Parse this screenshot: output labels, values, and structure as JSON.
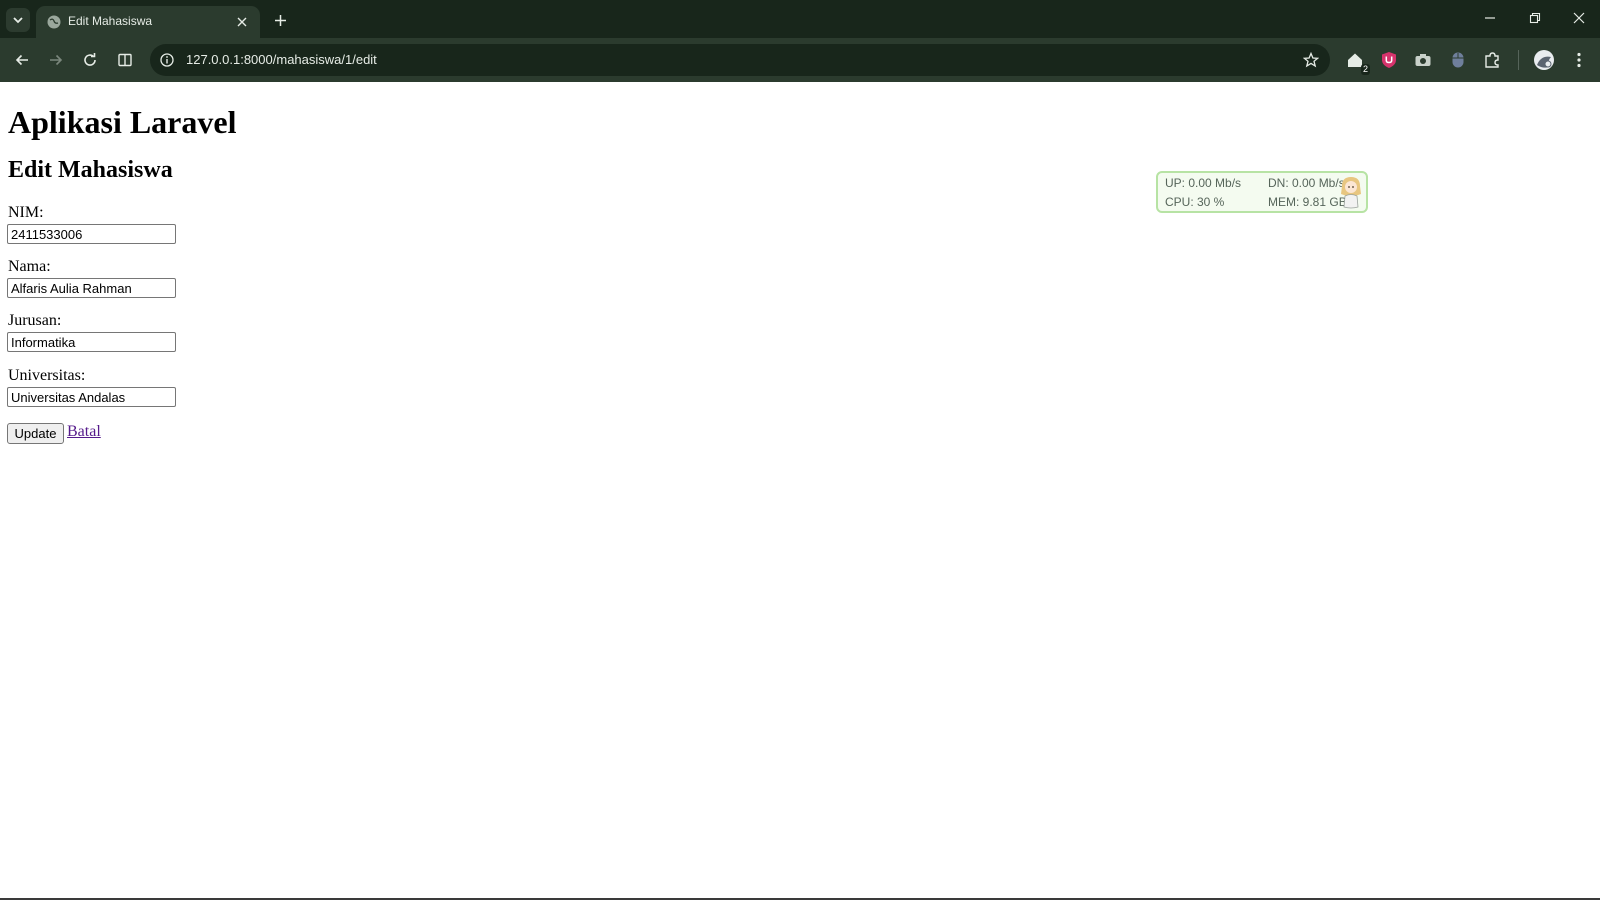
{
  "browser": {
    "tab_title": "Edit Mahasiswa",
    "url": "127.0.0.1:8000/mahasiswa/1/edit",
    "extension_badge": "2",
    "colors": {
      "frame": "#18261b",
      "toolbar": "#2b3b2e"
    },
    "icons": [
      "tab-list-icon",
      "globe-icon",
      "close-icon",
      "plus-icon",
      "minimize-icon",
      "restore-icon",
      "window-close-icon",
      "back-arrow-icon",
      "forward-arrow-icon",
      "reload-icon",
      "split-view-icon",
      "info-icon",
      "star-icon",
      "home-extension-icon",
      "shield-extension-icon",
      "camera-extension-icon",
      "mouse-extension-icon",
      "puzzle-icon",
      "profile-avatar-icon",
      "kebab-menu-icon"
    ]
  },
  "page": {
    "app_heading": "Aplikasi Laravel",
    "title": "Edit Mahasiswa",
    "form": {
      "nim": {
        "label": "NIM:",
        "value": "2411533006"
      },
      "nama": {
        "label": "Nama:",
        "value": "Alfaris Aulia Rahman"
      },
      "jurusan": {
        "label": "Jurusan:",
        "value": "Informatika"
      },
      "universitas": {
        "label": "Universitas:",
        "value": "Universitas Andalas"
      },
      "submit_label": "Update",
      "cancel_label": "Batal"
    },
    "link_color": "#551a8b"
  },
  "net_monitor": {
    "up": "UP: 0.00 Mb/s",
    "dn": "DN: 0.00 Mb/s",
    "cpu": "CPU: 30 %",
    "mem": "MEM: 9.81 GB"
  }
}
